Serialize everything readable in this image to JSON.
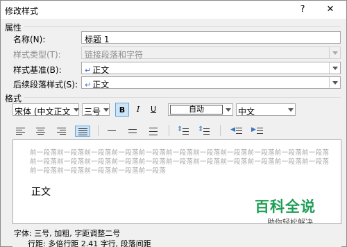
{
  "dialog": {
    "title": "修改样式",
    "help_label": "?",
    "close_label": "✕"
  },
  "properties": {
    "section_label": "属性",
    "name_label": "名称(N):",
    "name_value": "标题 1",
    "style_type_label": "样式类型(T):",
    "style_type_value": "链接段落和字符",
    "based_on_label": "样式基准(B):",
    "based_on_value": "正文",
    "following_label": "后续段落样式(S):",
    "following_value": "正文"
  },
  "format": {
    "section_label": "格式",
    "font_value": "宋体 (中文正文)",
    "size_value": "三号",
    "bold_label": "B",
    "italic_label": "I",
    "underline_label": "U",
    "color_value": "自动",
    "lang_value": "中文",
    "bold_active": true,
    "justify_active": true
  },
  "preview": {
    "prev_line_1": "前一段落前一段落前一段落前一段落前一段落前一段落前一段落前一段落前一段落前一段落前一段落",
    "prev_line_2": "前一段落前一段落前一段落前一段落前一段落",
    "sample_text": "正文",
    "watermark_main": "百科全说",
    "watermark_sub": "助你轻松解决"
  },
  "description": {
    "line_1": "字体: 三号, 加粗, 字距调整二号",
    "line_2": "行距: 多倍行距 2.41 字行, 段落间距"
  },
  "colors": {
    "accent": "#5fa4dc",
    "watermark": "#1f9e56",
    "paragraph_mark": "#3b6fc3"
  }
}
